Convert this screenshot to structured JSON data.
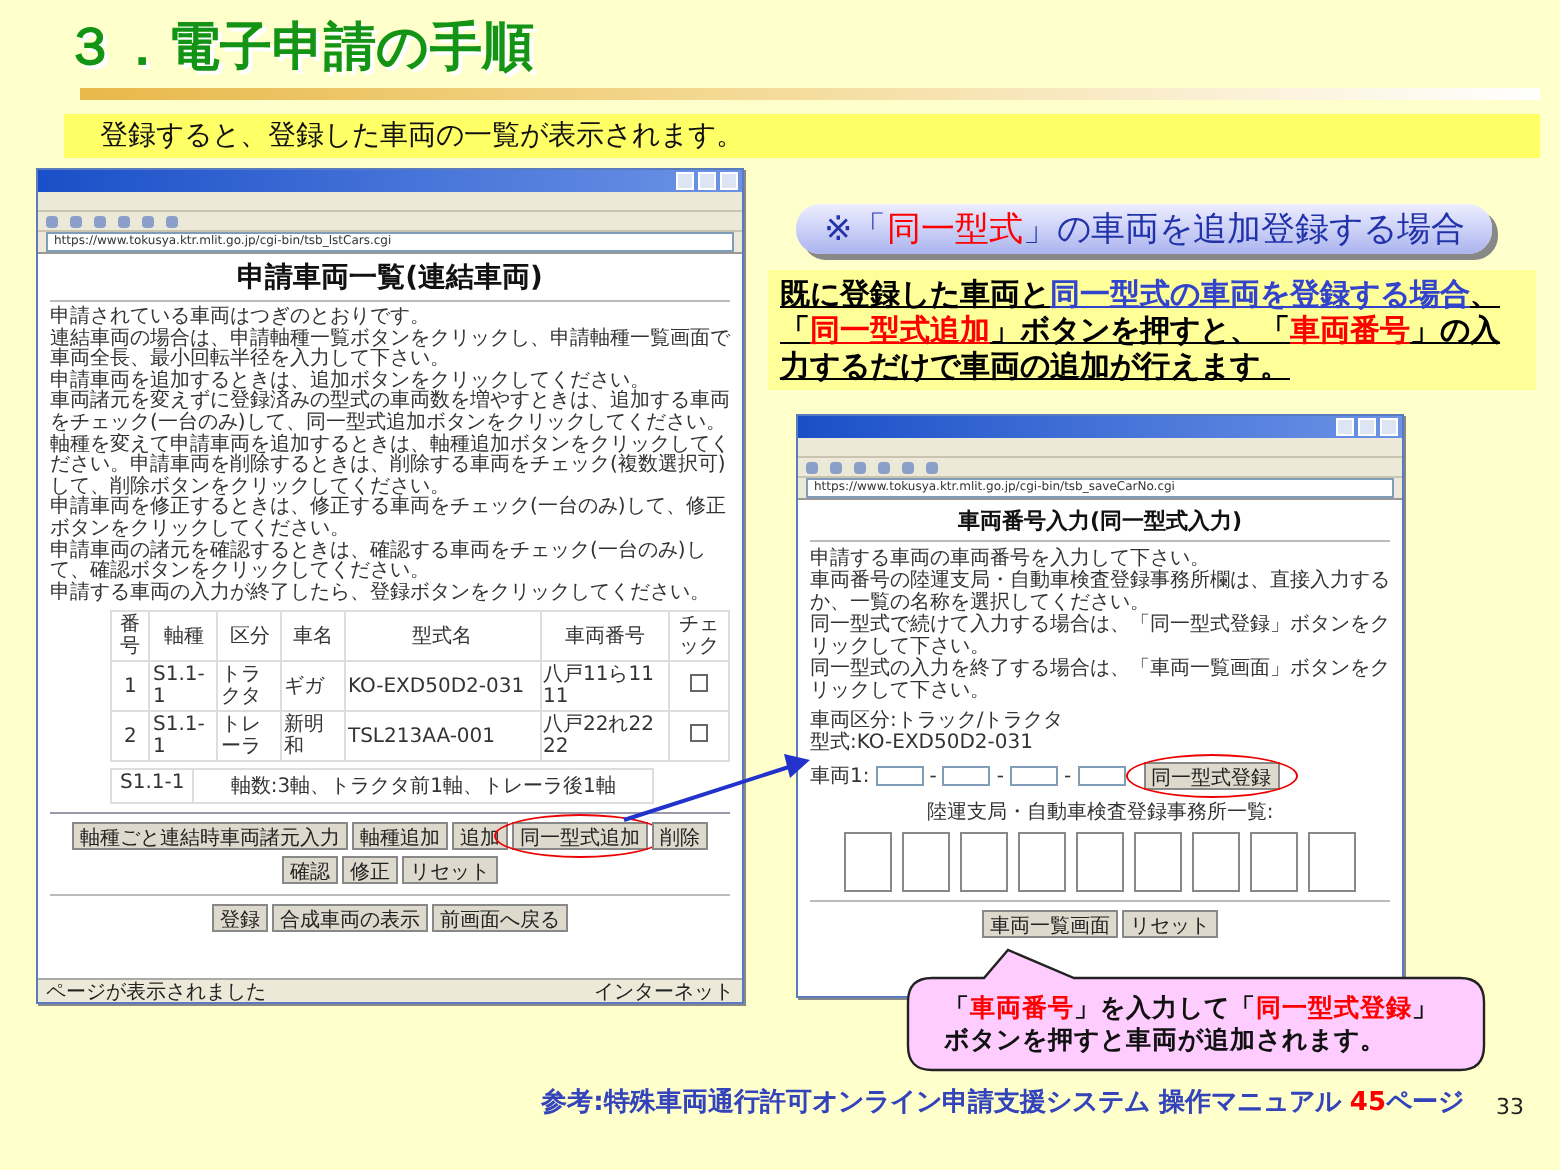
{
  "slide": {
    "title": "３．電子申請の手順",
    "subtitle": "登録すると、登録した車両の一覧が表示されます。",
    "page_number": "33"
  },
  "left_window": {
    "address": "https://www.tokusya.ktr.mlit.go.jp/cgi-bin/tsb_lstCars.cgi",
    "heading": "申請車両一覧(連結車両)",
    "paragraphs": [
      "申請されている車両はつぎのとおりです。",
      "連結車両の場合は、申請軸種一覧ボタンをクリックし、申請軸種一覧画面で車両全長、最小回転半径を入力して下さい。",
      "申請車両を追加するときは、追加ボタンをクリックしてください。",
      "車両諸元を変えずに登録済みの型式の車両数を増やすときは、追加する車両をチェック(一台のみ)して、同一型式追加ボタンをクリックしてください。",
      "軸種を変えて申請車両を追加するときは、軸種追加ボタンをクリックしてください。申請車両を削除するときは、削除する車両をチェック(複数選択可)して、削除ボタンをクリックしてください。",
      "申請車両を修正するときは、修正する車両をチェック(一台のみ)して、修正ボタンをクリックしてください。",
      "申請車両の諸元を確認するときは、確認する車両をチェック(一台のみ)して、確認ボタンをクリックしてください。",
      "申請する車両の入力が終了したら、登録ボタンをクリックしてください。"
    ],
    "table": {
      "columns": [
        "番号",
        "軸種",
        "区分",
        "車名",
        "型式名",
        "車両番号",
        "チェック"
      ],
      "rows": [
        {
          "cells": [
            "1",
            "S1.1-1",
            "トラクタ",
            "ギガ",
            "KO-EXD50D2-031",
            "八戸11ら1111"
          ],
          "checked": false
        },
        {
          "cells": [
            "2",
            "S1.1-1",
            "トレーラ",
            "新明和",
            "TSL213AA-001",
            "八戸22れ2222"
          ],
          "checked": false
        }
      ]
    },
    "axle_summary": [
      "S1.1-1",
      "軸数:3軸、トラクタ前1軸、トレーラ後1軸"
    ],
    "buttons": [
      {
        "label": "軸種ごと連結時車両諸元入力",
        "circled": false
      },
      {
        "label": "軸種追加",
        "circled": false
      },
      {
        "label": "追加",
        "circled": false
      },
      {
        "label": "同一型式追加",
        "circled": true
      },
      {
        "label": "削除",
        "circled": false
      },
      {
        "label": "確認",
        "circled": false
      },
      {
        "label": "修正",
        "circled": false
      },
      {
        "label": "リセット",
        "circled": false
      }
    ],
    "bottom_buttons": [
      "登録",
      "合成車両の表示",
      "前画面へ戻る"
    ],
    "status": "ページが表示されました",
    "zone": "インターネット"
  },
  "banner": {
    "segments": [
      {
        "text": "※「",
        "kind": "plain"
      },
      {
        "text": "同一型式",
        "kind": "red"
      },
      {
        "text": "」の車両を追加登録する場合",
        "kind": "plain"
      }
    ]
  },
  "explanation": {
    "segments": [
      {
        "text": "既に登録した車両と",
        "kind": "plain"
      },
      {
        "text": "同一型式の車両を登録する場合",
        "kind": "blue"
      },
      {
        "text": "、「",
        "kind": "plain"
      },
      {
        "text": "同一型式追加",
        "kind": "red"
      },
      {
        "text": "」ボタンを押すと、「",
        "kind": "plain"
      },
      {
        "text": "車両番号",
        "kind": "red"
      },
      {
        "text": "」の入力するだけで車両の追加が行えます。",
        "kind": "plain"
      }
    ]
  },
  "right_window": {
    "address": "https://www.tokusya.ktr.mlit.go.jp/cgi-bin/tsb_saveCarNo.cgi",
    "heading": "車両番号入力(同一型式入力)",
    "paragraphs": [
      "申請する車両の車両番号を入力して下さい。",
      "車両番号の陸運支局・自動車検査登録事務所欄は、直接入力するか、一覧の名称を選択してください。",
      "同一型式で続けて入力する場合は、「同一型式登録」ボタンをクリックして下さい。",
      "同一型式の入力を終了する場合は、「車両一覧画面」ボタンをクリックして下さい。"
    ],
    "vehicle_info": [
      "車両区分:トラック/トラクタ",
      "型式:KO-EXD50D2-031"
    ],
    "number_label": "車両1:",
    "number_fields": [
      {
        "kind": "input"
      },
      {
        "kind": "separator",
        "text": "-"
      },
      {
        "kind": "input"
      },
      {
        "kind": "separator",
        "text": "-"
      },
      {
        "kind": "input"
      },
      {
        "kind": "separator",
        "text": "-"
      },
      {
        "kind": "input"
      }
    ],
    "register_button": {
      "label": "同一型式登録",
      "circled": true
    },
    "list_title": "陸運支局・自動車検査登録事務所一覧:",
    "office_lists": [
      {
        "kind": "listbox"
      },
      {
        "kind": "listbox"
      },
      {
        "kind": "listbox"
      },
      {
        "kind": "listbox"
      },
      {
        "kind": "listbox"
      },
      {
        "kind": "listbox"
      },
      {
        "kind": "listbox"
      },
      {
        "kind": "listbox"
      },
      {
        "kind": "listbox"
      }
    ],
    "buttons": [
      "車両一覧画面",
      "リセット"
    ]
  },
  "callout": {
    "segments": [
      {
        "text": "「",
        "kind": "plain"
      },
      {
        "text": "車両番号",
        "kind": "red"
      },
      {
        "text": "」を入力して「",
        "kind": "plain"
      },
      {
        "text": "同一型式登録",
        "kind": "red"
      },
      {
        "text": "」ボタンを押すと車両が追加されます。",
        "kind": "plain"
      }
    ]
  },
  "reference": {
    "segments": [
      {
        "text": "参考:特殊車両通行許可オンライン申請支援システム 操作マニュアル ",
        "kind": "plain"
      },
      {
        "text": "45",
        "kind": "red"
      },
      {
        "text": "ページ",
        "kind": "plain"
      }
    ]
  }
}
